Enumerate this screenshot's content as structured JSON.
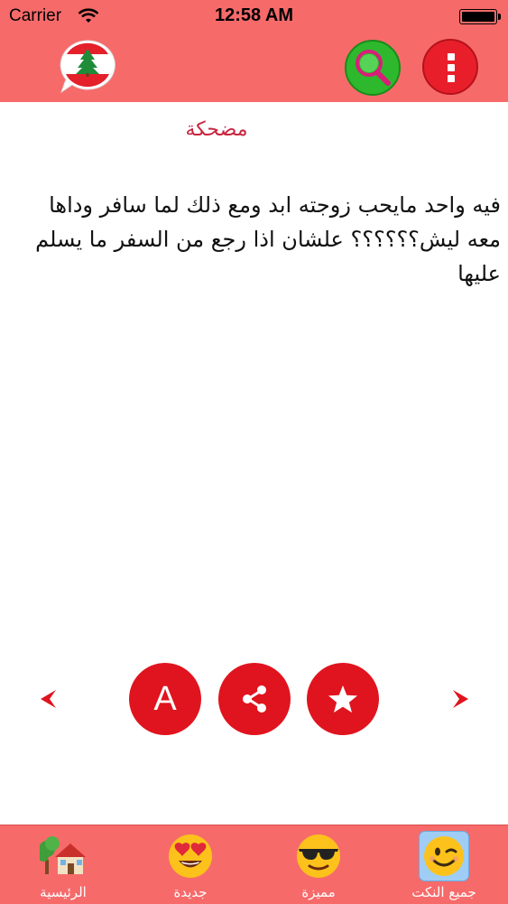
{
  "status_bar": {
    "carrier": "Carrier",
    "time": "12:58 AM"
  },
  "header": {
    "logo_icon": "lebanon-flag-chat-icon",
    "search_icon": "magnifier-icon",
    "menu_icon": "vertical-dots-icon",
    "accent_color": "#f76a6a"
  },
  "content": {
    "category": "مضحكة",
    "joke_text": "فيه واحد مايحب زوجته ابد ومع ذلك لما سافر وداها معه ليش؟؟؟؟؟؟ علشان اذا رجع من السفر ما يسلم عليها"
  },
  "actions": {
    "font_label": "A",
    "font_icon": "font-size-icon",
    "share_icon": "share-icon",
    "favorite_icon": "star-icon",
    "prev_icon": "arrow-left-icon",
    "next_icon": "arrow-right-icon"
  },
  "tabs": [
    {
      "label": "الرئيسية",
      "icon": "house-tree-icon"
    },
    {
      "label": "جديدة",
      "icon": "heart-eyes-emoji-icon"
    },
    {
      "label": "مميزة",
      "icon": "sunglasses-emoji-icon"
    },
    {
      "label": "جميع النكت",
      "icon": "winking-face-icon"
    }
  ]
}
